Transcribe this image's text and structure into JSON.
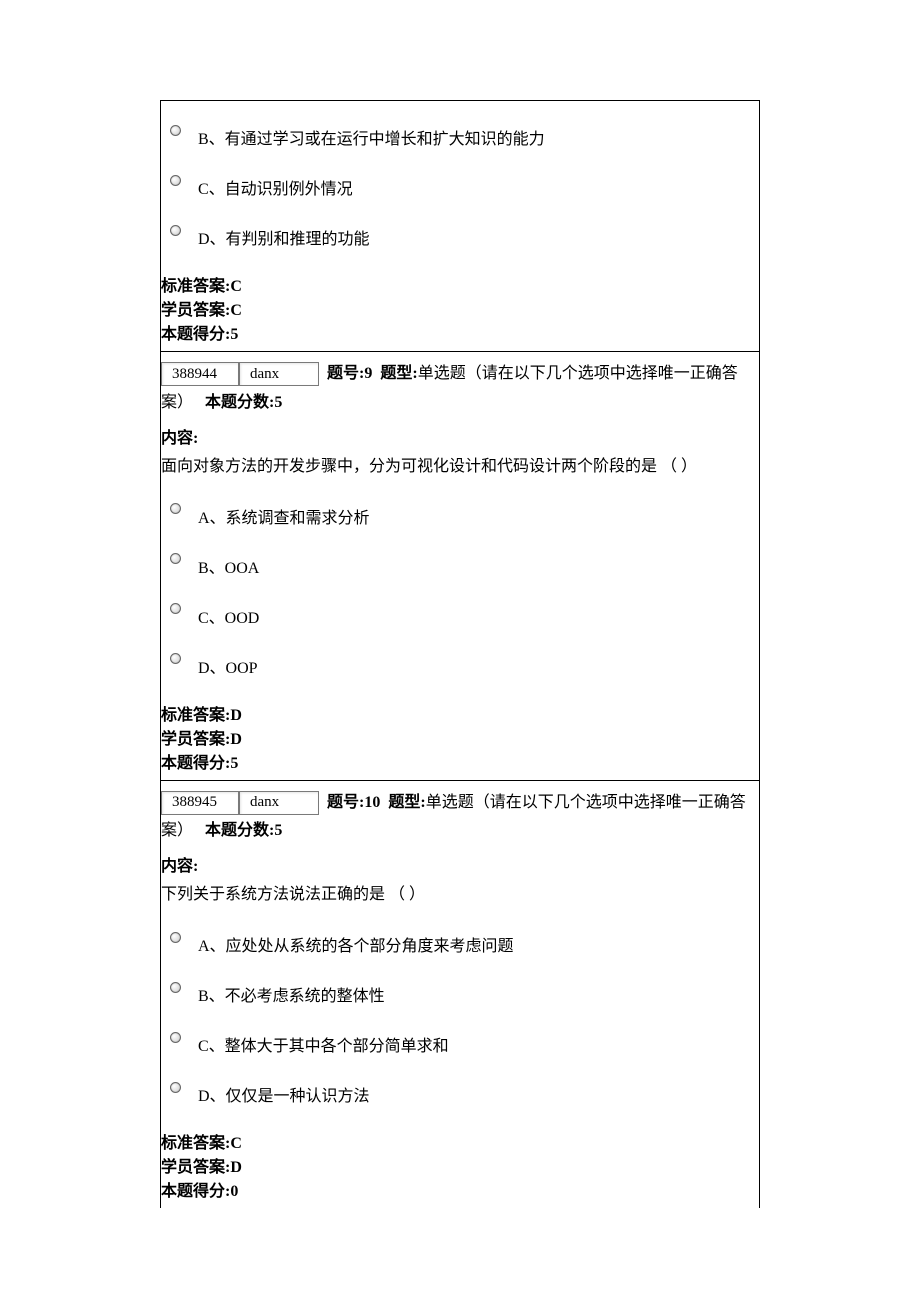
{
  "blocks": [
    {
      "showHeader": false,
      "options": [
        {
          "label": "B、有通过学习或在运行中增长和扩大知识的能力"
        },
        {
          "label": "C、自动识别例外情况"
        },
        {
          "label": "D、有判别和推理的功能"
        }
      ],
      "stdAnswerLabel": "标准答案:",
      "stdAnswer": "C",
      "stuAnswerLabel": "学员答案:",
      "stuAnswer": "C",
      "scoreLabel": "本题得分:",
      "score": "5"
    },
    {
      "showHeader": true,
      "header": {
        "idValue": "388944",
        "typeValue": "danx",
        "numLabel": "题号:",
        "num": "9",
        "typeLabel": "题型:",
        "typeDesc": "单选题（请在以下几个选项中选择唯一正确答案）",
        "pointsLabel": "本题分数:",
        "points": "5"
      },
      "contentLabel": "内容:",
      "contentBody": "面向对象方法的开发步骤中，分为可视化设计和代码设计两个阶段的是  （ ）",
      "options": [
        {
          "label": "A、系统调查和需求分析"
        },
        {
          "label": "B、OOA"
        },
        {
          "label": "C、OOD"
        },
        {
          "label": "D、OOP"
        }
      ],
      "stdAnswerLabel": "标准答案:",
      "stdAnswer": "D",
      "stuAnswerLabel": "学员答案:",
      "stuAnswer": "D",
      "scoreLabel": "本题得分:",
      "score": "5"
    },
    {
      "showHeader": true,
      "header": {
        "idValue": "388945",
        "typeValue": "danx",
        "numLabel": "题号:",
        "num": "10",
        "typeLabel": "题型:",
        "typeDesc": "单选题（请在以下几个选项中选择唯一正确答案）",
        "pointsLabel": "本题分数:",
        "points": "5"
      },
      "contentLabel": "内容:",
      "contentBody": "下列关于系统方法说法正确的是  （ ）",
      "options": [
        {
          "label": "A、应处处从系统的各个部分角度来考虑问题"
        },
        {
          "label": "B、不必考虑系统的整体性"
        },
        {
          "label": "C、整体大于其中各个部分简单求和"
        },
        {
          "label": "D、仅仅是一种认识方法"
        }
      ],
      "stdAnswerLabel": "标准答案:",
      "stdAnswer": "C",
      "stuAnswerLabel": "学员答案:",
      "stuAnswer": "D",
      "scoreLabel": "本题得分:",
      "score": "0"
    }
  ]
}
